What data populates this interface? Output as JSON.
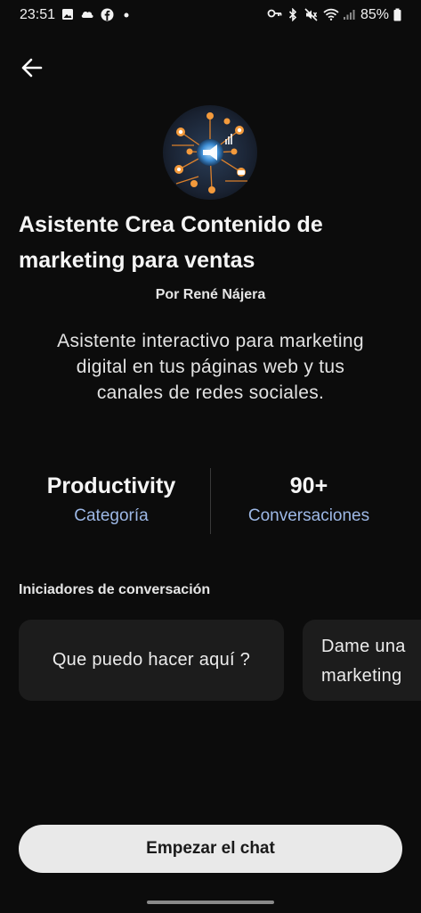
{
  "status_bar": {
    "time": "23:51",
    "battery_percent": "85%",
    "left_icons": [
      "gallery-icon",
      "cloud-icon",
      "facebook-icon",
      "dot-icon"
    ],
    "right_icons": [
      "key-icon",
      "bluetooth-icon",
      "mute-icon",
      "wifi-icon",
      "signal-icon",
      "battery-icon"
    ]
  },
  "header": {
    "back_icon": "arrow-left-icon"
  },
  "profile": {
    "title": "Asistente Crea Contenido de marketing para ventas",
    "author": "Por René Nájera",
    "description": "Asistente interactivo para marketing digital en tus páginas web y tus canales de redes sociales."
  },
  "stats": {
    "category_value": "Productivity",
    "category_label": "Categoría",
    "conversations_value": "90+",
    "conversations_label": "Conversaciones"
  },
  "starters": {
    "heading": "Iniciadores de conversación",
    "items": [
      "Que puedo hacer aquí ?",
      "Dame una marketing"
    ],
    "item2_line1": "Dame una",
    "item2_line2": "marketing"
  },
  "cta": {
    "label": "Empezar el chat"
  },
  "colors": {
    "background": "#0c0c0c",
    "accent_label": "#9db8e6",
    "card": "#1c1c1c",
    "cta_bg": "#e9e9e9"
  }
}
